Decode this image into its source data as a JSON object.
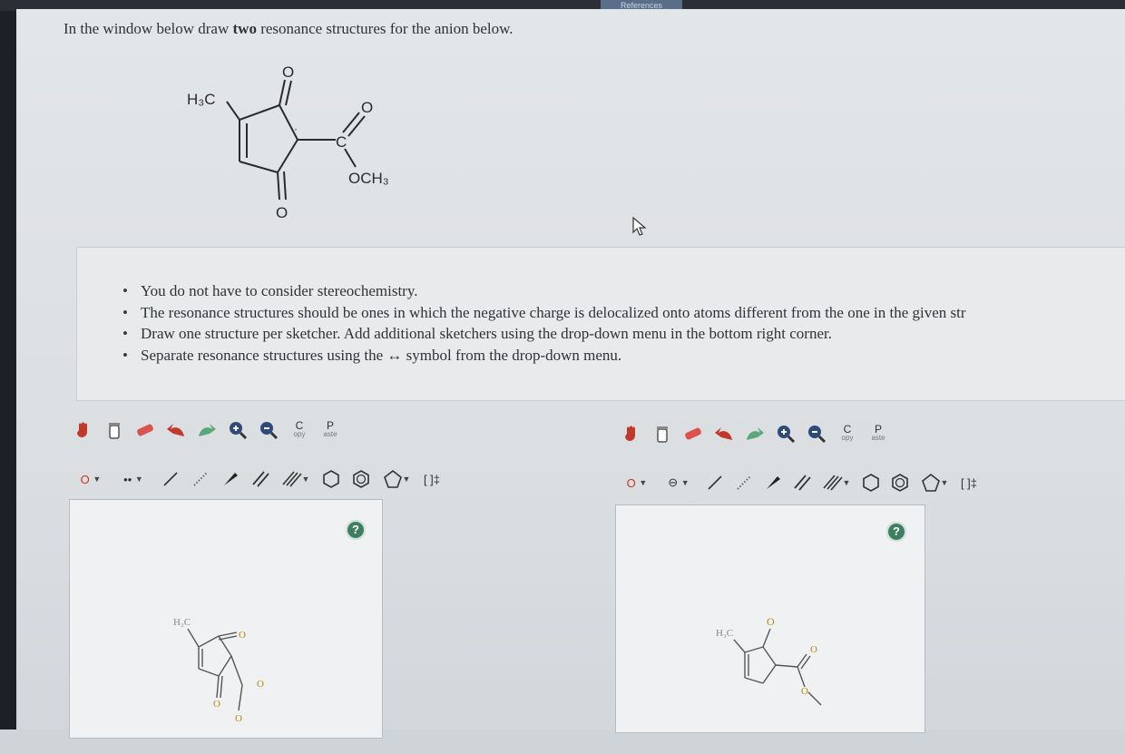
{
  "topbar": {
    "tab_label": "References"
  },
  "prompt": {
    "pre": "In the window below draw ",
    "bold": "two",
    "post": " resonance structures for the anion below."
  },
  "molecule": {
    "methyl_label": "H₃C",
    "ketone_top": "O",
    "ester_carbonyl_o": "O",
    "ester_c": "C",
    "methoxy": "OCH₃",
    "ketone_bottom": "O",
    "lone_pair": "··"
  },
  "instructions": [
    "You do not have to consider stereochemistry.",
    "The resonance structures should be ones in which the negative charge is delocalized onto atoms different from the one in the given str",
    "Draw one structure per sketcher. Add additional sketchers using the drop-down menu in the bottom right corner.",
    "Separate resonance structures using the ↔ symbol from the drop-down menu."
  ],
  "sketchers": [
    {
      "copy_label": "C",
      "copy_sub": "opy",
      "paste_label": "P",
      "paste_sub": "aste",
      "atom_value": "O",
      "charge_value": "••",
      "help_label": "?",
      "bracket_label": "[ ]‡",
      "drawing": {
        "methyl": "H₃C",
        "o1": "O",
        "o2": "O",
        "o3": "O",
        "o_anion": "O"
      }
    },
    {
      "copy_label": "C",
      "copy_sub": "opy",
      "paste_label": "P",
      "paste_sub": "aste",
      "atom_value": "O",
      "charge_value": "⊖",
      "help_label": "?",
      "bracket_label": "[ ]‡",
      "drawing": {
        "methyl": "H₃C",
        "o_anion": "O",
        "o1": "O",
        "o2": "O"
      }
    }
  ],
  "colors": {
    "help_green": "#3f7f61",
    "hand_red": "#c0392b",
    "eraser_red": "#d9534f",
    "undo_green": "#5aa87a"
  }
}
